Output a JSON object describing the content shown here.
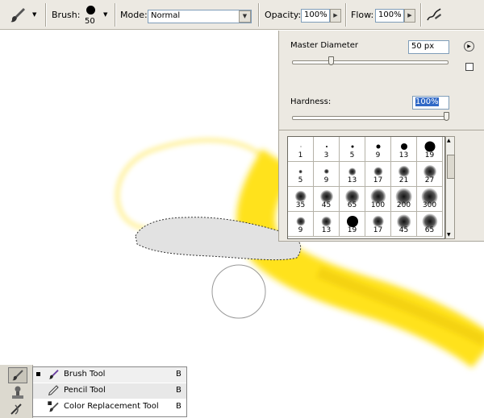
{
  "options_bar": {
    "brush_label": "Brush:",
    "brush_size": "50",
    "mode_label": "Mode:",
    "mode_value": "Normal",
    "opacity_label": "Opacity:",
    "opacity_value": "100%",
    "flow_label": "Flow:",
    "flow_value": "100%",
    "icons": [
      "brush-tool-icon",
      "dropdown-arrow-icon",
      "brush-preview-icon",
      "airbrush-icon"
    ]
  },
  "brush_panel": {
    "master_diameter_label": "Master Diameter",
    "master_diameter_value": "50 px",
    "master_diameter_slider": 0.25,
    "hardness_label": "Hardness:",
    "hardness_value": "100%",
    "hardness_slider": 1.0,
    "presets": [
      {
        "size": "1",
        "dot": 1,
        "soft": false
      },
      {
        "size": "3",
        "dot": 2,
        "soft": false
      },
      {
        "size": "5",
        "dot": 3,
        "soft": false
      },
      {
        "size": "9",
        "dot": 5,
        "soft": false
      },
      {
        "size": "13",
        "dot": 8,
        "soft": false
      },
      {
        "size": "19",
        "dot": 13,
        "soft": false
      },
      {
        "size": "5",
        "dot": 3,
        "soft": true
      },
      {
        "size": "9",
        "dot": 4,
        "soft": true
      },
      {
        "size": "13",
        "dot": 6,
        "soft": true
      },
      {
        "size": "17",
        "dot": 7,
        "soft": true
      },
      {
        "size": "21",
        "dot": 9,
        "soft": true
      },
      {
        "size": "27",
        "dot": 10,
        "soft": true
      },
      {
        "size": "35",
        "dot": 9,
        "soft": true
      },
      {
        "size": "45",
        "dot": 10,
        "soft": true
      },
      {
        "size": "65",
        "dot": 11,
        "soft": true
      },
      {
        "size": "100",
        "dot": 12,
        "soft": true
      },
      {
        "size": "200",
        "dot": 13,
        "soft": true
      },
      {
        "size": "300",
        "dot": 13,
        "soft": true
      },
      {
        "size": "9",
        "dot": 7,
        "soft": true
      },
      {
        "size": "13",
        "dot": 8,
        "soft": true
      },
      {
        "size": "19",
        "dot": 14,
        "soft": false
      },
      {
        "size": "17",
        "dot": 9,
        "soft": true
      },
      {
        "size": "45",
        "dot": 11,
        "soft": true
      },
      {
        "size": "65",
        "dot": 12,
        "soft": true
      }
    ]
  },
  "flyout": {
    "items": [
      {
        "name": "Brush Tool",
        "key": "B",
        "selected": true
      },
      {
        "name": "Pencil Tool",
        "key": "B",
        "selected": false
      },
      {
        "name": "Color Replacement Tool",
        "key": "B",
        "selected": false
      }
    ]
  },
  "colors": {
    "stroke_yellow": "#ffe21a",
    "chrome": "#ece9e2",
    "highlight": "#3169c6"
  }
}
